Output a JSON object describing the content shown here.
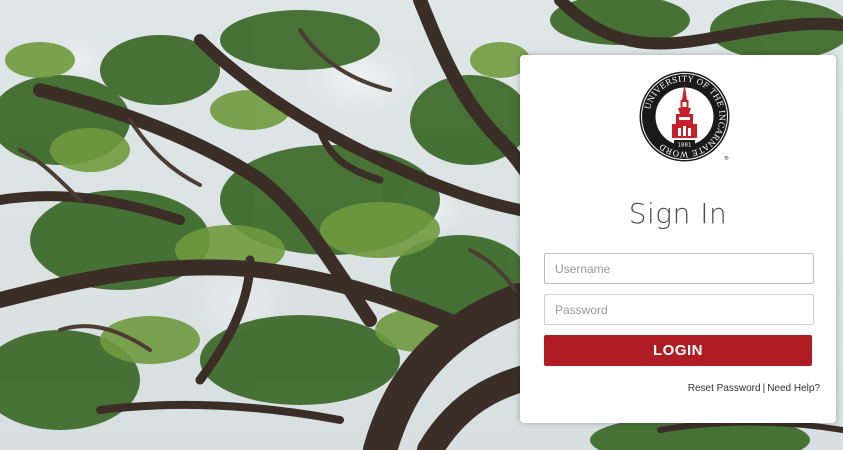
{
  "background": {
    "icon": "oak-tree-photo"
  },
  "logo": {
    "ring_text": "UNIVERSITY OF THE INCARNATE WORD",
    "year": "1881",
    "icon": "uiw-seal-icon",
    "colors": {
      "red": "#c8202b",
      "black": "#1a1a1a"
    }
  },
  "login": {
    "title": "Sign In",
    "username_placeholder": "Username",
    "password_placeholder": "Password",
    "button_label": "LOGIN",
    "reset_password": "Reset Password",
    "separator": "|",
    "need_help": "Need Help?"
  },
  "colors": {
    "accent": "#b01c23"
  }
}
